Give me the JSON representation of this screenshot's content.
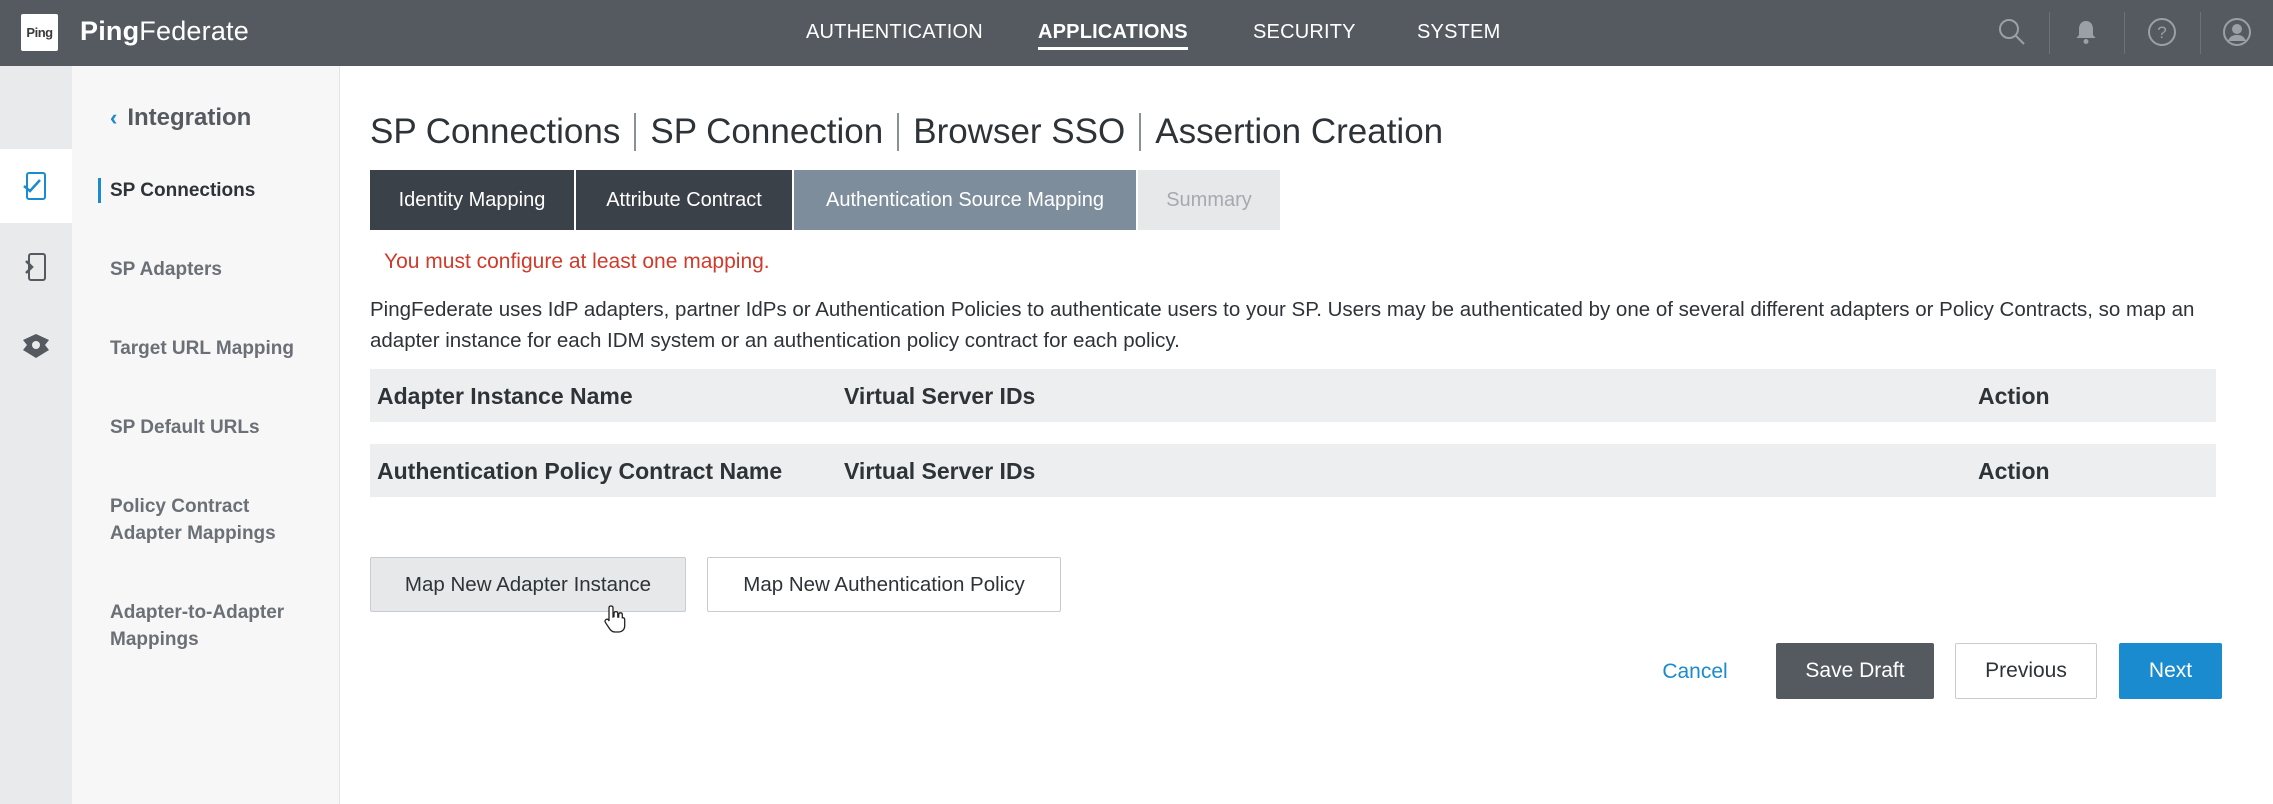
{
  "app": {
    "logo_text": "Ping",
    "brand_bold": "Ping",
    "brand_light": "Federate"
  },
  "topnav": {
    "items": [
      {
        "label": "AUTHENTICATION",
        "active": false
      },
      {
        "label": "APPLICATIONS",
        "active": true
      },
      {
        "label": "SECURITY",
        "active": false
      },
      {
        "label": "SYSTEM",
        "active": false
      }
    ],
    "icons": [
      "search-icon",
      "bell-icon",
      "help-icon",
      "user-icon"
    ]
  },
  "rail": {
    "icons": [
      "applications-icon",
      "sp-icon",
      "oauth-icon"
    ]
  },
  "sidebar": {
    "header": "Integration",
    "items": [
      {
        "label": "SP Connections",
        "active": true
      },
      {
        "label": "SP Adapters",
        "active": false
      },
      {
        "label": "Target URL Mapping",
        "active": false
      },
      {
        "label": "SP Default URLs",
        "active": false
      },
      {
        "label": "Policy Contract Adapter Mappings",
        "active": false
      },
      {
        "label": "Adapter-to-Adapter Mappings",
        "active": false
      }
    ]
  },
  "breadcrumb": [
    "SP Connections",
    "SP Connection",
    "Browser SSO",
    "Assertion Creation"
  ],
  "tabs": [
    {
      "label": "Identity Mapping",
      "state": "done"
    },
    {
      "label": "Attribute Contract",
      "state": "done"
    },
    {
      "label": "Authentication Source Mapping",
      "state": "current"
    },
    {
      "label": "Summary",
      "state": "future"
    }
  ],
  "error_message": "You must configure at least one mapping.",
  "description": "PingFederate uses IdP adapters, partner IdPs or Authentication Policies to authenticate users to your SP. Users may be authenticated by one of several different adapters or Policy Contracts, so map an adapter instance for each IDM system or an authentication policy contract for each policy.",
  "adapter_table": {
    "columns": [
      "Adapter Instance Name",
      "Virtual Server IDs",
      "Action"
    ]
  },
  "policy_table": {
    "columns": [
      "Authentication Policy Contract Name",
      "Virtual Server IDs",
      "Action"
    ]
  },
  "buttons": {
    "map_adapter": "Map New Adapter Instance",
    "map_policy": "Map New Authentication Policy",
    "cancel": "Cancel",
    "save_draft": "Save Draft",
    "previous": "Previous",
    "next": "Next"
  },
  "colors": {
    "topbar": "#545a60",
    "accent": "#1b8bcf",
    "error": "#d03a2a",
    "tab_done": "#3a4148",
    "tab_current": "#7e8d9b"
  }
}
